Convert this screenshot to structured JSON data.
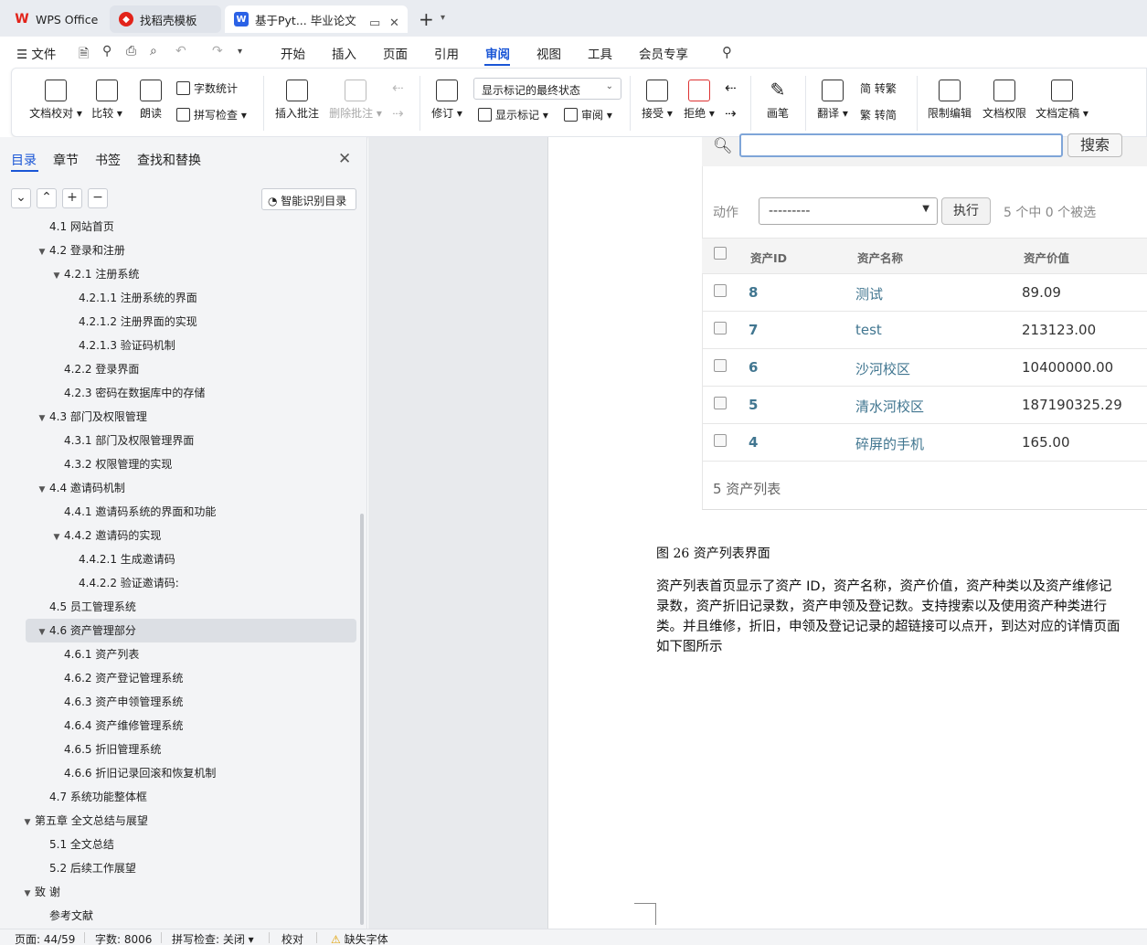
{
  "titlebar": {
    "tabs": [
      {
        "label": "WPS Office"
      },
      {
        "label": "找稻壳模板"
      },
      {
        "label": "基于Pyt... 毕业论文"
      }
    ]
  },
  "menubar": {
    "file": "文件",
    "items": [
      "开始",
      "插入",
      "页面",
      "引用",
      "审阅",
      "视图",
      "工具",
      "会员专享"
    ],
    "active": "审阅"
  },
  "ribbon": {
    "doc_check": "文档校对",
    "compare": "比较",
    "read_aloud": "朗读",
    "word_count": "字数统计",
    "spell_check": "拼写检查",
    "insert_comment": "插入批注",
    "delete_comment": "删除批注",
    "track_changes": "修订",
    "display_select": "显示标记的最终状态",
    "show_markup": "显示标记",
    "review_pane": "审阅",
    "accept": "接受",
    "reject": "拒绝",
    "pen": "画笔",
    "translate": "翻译",
    "to_traditional": "简 转繁",
    "to_simplified": "繁 转简",
    "restrict_edit": "限制编辑",
    "doc_permission": "文档权限",
    "doc_finalize": "文档定稿"
  },
  "nav": {
    "tabs": [
      "目录",
      "章节",
      "书签",
      "查找和替换"
    ],
    "smart_toc": "智能识别目录",
    "toc": [
      {
        "label": "4.1  网站首页",
        "level": 1,
        "arrow": false
      },
      {
        "label": "4.2  登录和注册",
        "level": 1,
        "arrow": true
      },
      {
        "label": "4.2.1  注册系统",
        "level": 2,
        "arrow": true
      },
      {
        "label": "4.2.1.1 注册系统的界面",
        "level": 3,
        "arrow": false
      },
      {
        "label": "4.2.1.2  注册界面的实现",
        "level": 3,
        "arrow": false
      },
      {
        "label": "4.2.1.3  验证码机制",
        "level": 3,
        "arrow": false
      },
      {
        "label": "4.2.2  登录界面",
        "level": 2,
        "arrow": false
      },
      {
        "label": "4.2.3  密码在数据库中的存储",
        "level": 2,
        "arrow": false
      },
      {
        "label": "4.3  部门及权限管理",
        "level": 1,
        "arrow": true
      },
      {
        "label": "4.3.1  部门及权限管理界面",
        "level": 2,
        "arrow": false
      },
      {
        "label": "4.3.2  权限管理的实现",
        "level": 2,
        "arrow": false
      },
      {
        "label": "4.4  邀请码机制",
        "level": 1,
        "arrow": true
      },
      {
        "label": "4.4.1  邀请码系统的界面和功能",
        "level": 2,
        "arrow": false
      },
      {
        "label": "4.4.2  邀请码的实现",
        "level": 2,
        "arrow": true
      },
      {
        "label": "4.4.2.1  生成邀请码",
        "level": 3,
        "arrow": false
      },
      {
        "label": "4.4.2.2  验证邀请码:",
        "level": 3,
        "arrow": false
      },
      {
        "label": "4.5  员工管理系统",
        "level": 1,
        "arrow": false
      },
      {
        "label": "4.6  资产管理部分",
        "level": 1,
        "arrow": true,
        "selected": true
      },
      {
        "label": "4.6.1  资产列表",
        "level": 2,
        "arrow": false
      },
      {
        "label": "4.6.2  资产登记管理系统",
        "level": 2,
        "arrow": false
      },
      {
        "label": "4.6.3  资产申领管理系统",
        "level": 2,
        "arrow": false
      },
      {
        "label": "4.6.4  资产维修管理系统",
        "level": 2,
        "arrow": false
      },
      {
        "label": "4.6.5  折旧管理系统",
        "level": 2,
        "arrow": false
      },
      {
        "label": "4.6.6 折旧记录回滚和恢复机制",
        "level": 2,
        "arrow": false
      },
      {
        "label": "4.7  系统功能整体框",
        "level": 1,
        "arrow": false
      },
      {
        "label": "第五章  全文总结与展望",
        "level": 0,
        "arrow": true
      },
      {
        "label": "5.1  全文总结",
        "level": 1,
        "arrow": false
      },
      {
        "label": "5.2  后续工作展望",
        "level": 1,
        "arrow": false
      },
      {
        "label": "致  谢",
        "level": 0,
        "arrow": true
      },
      {
        "label": "参考文献",
        "level": 1,
        "arrow": false
      }
    ]
  },
  "doc": {
    "shot": {
      "search_btn": "搜索",
      "action_label": "动作",
      "action_select": "---------",
      "run_btn": "执行",
      "selection_count": "5 个中 0 个被选",
      "headers": [
        "资产ID",
        "资产名称",
        "资产价值"
      ],
      "rows": [
        {
          "id": "8",
          "name": "测试",
          "value": "89.09"
        },
        {
          "id": "7",
          "name": "test",
          "value": "213123.00"
        },
        {
          "id": "6",
          "name": "沙河校区",
          "value": "10400000.00"
        },
        {
          "id": "5",
          "name": "清水河校区",
          "value": "187190325.29"
        },
        {
          "id": "4",
          "name": "碎屏的手机",
          "value": "165.00"
        }
      ],
      "footer": "5 资产列表"
    },
    "caption": "图 26  资产列表界面",
    "paragraph": [
      "资产列表首页显示了资产 ID，资产名称，资产价值，资产种类以及资产维修记",
      "录数，资产折旧记录数，资产申领及登记数。支持搜索以及使用资产种类进行",
      "类。并且维修，折旧，申领及登记记录的超链接可以点开，到达对应的详情页面",
      "如下图所示"
    ]
  },
  "status": {
    "page": "页面: 44/59",
    "words": "字数: 8006",
    "spell": "拼写检查: 关闭",
    "proof": "校对",
    "missing_font": "缺失字体"
  },
  "colors": {
    "accent": "#1a56d6",
    "link": "#417690",
    "wps_red": "#e2231a"
  }
}
